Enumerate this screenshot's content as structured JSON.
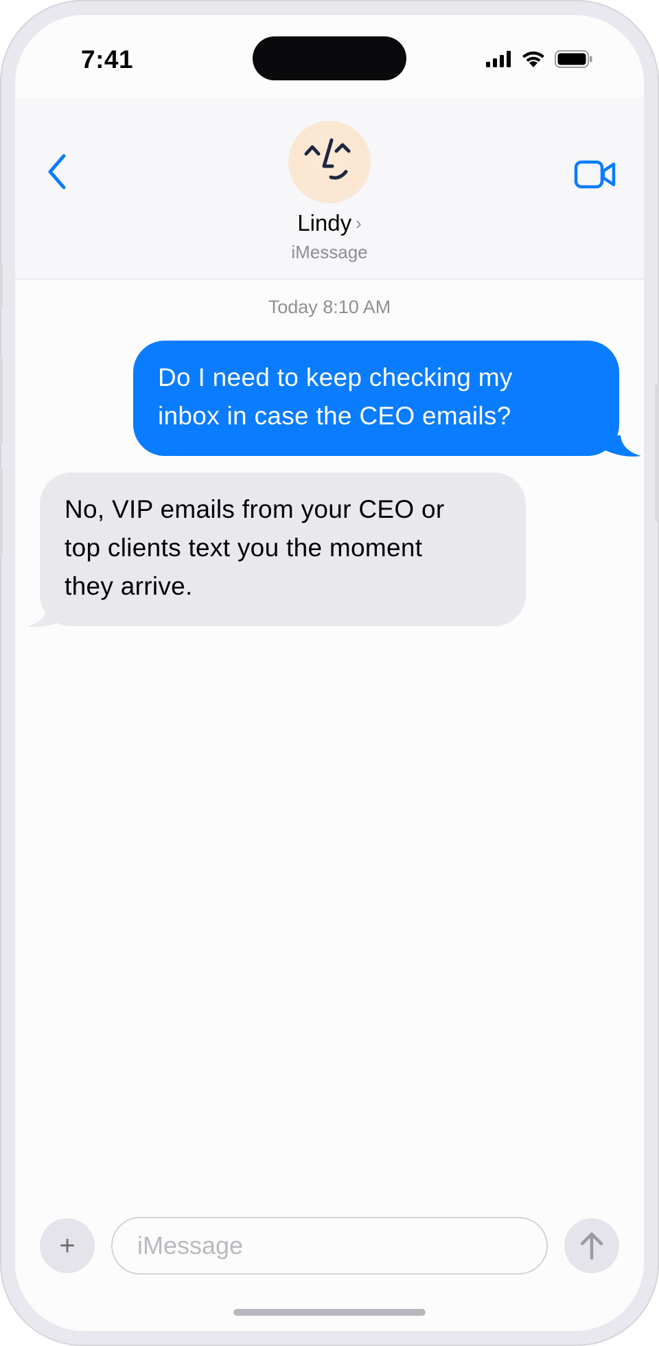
{
  "status_bar": {
    "time": "7:41"
  },
  "header": {
    "contact_name": "Lindy",
    "chevron": "›",
    "subtitle": "iMessage",
    "back_icon": "chevron-left-icon",
    "video_icon": "video-camera-icon",
    "accent_color": "#0a7cff"
  },
  "conversation": {
    "timestamp": "Today 8:10 AM",
    "messages": [
      {
        "sender": "me",
        "lines": [
          "Do I need to keep checking my",
          "inbox in case the CEO emails?"
        ]
      },
      {
        "sender": "Lindy",
        "lines": [
          "No, VIP emails from your CEO or",
          "top clients text you the moment",
          "they arrive."
        ]
      }
    ]
  },
  "composer": {
    "plus_label": "+",
    "placeholder": "iMessage",
    "value": "",
    "send_icon": "arrow-up-icon"
  },
  "colors": {
    "outgoing_bubble": "#0a7cff",
    "incoming_bubble": "#e9e8ed"
  }
}
